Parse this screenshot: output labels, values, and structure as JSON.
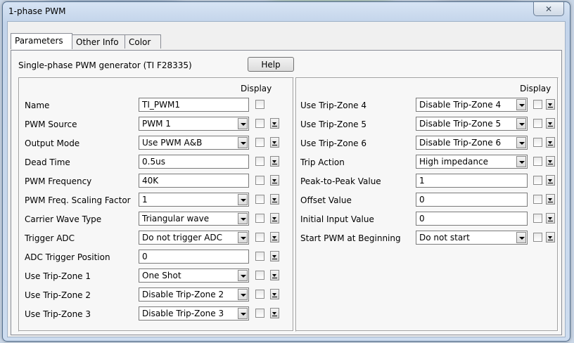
{
  "window": {
    "title": "1-phase PWM"
  },
  "tabs": [
    "Parameters",
    "Other Info",
    "Color"
  ],
  "header": {
    "subtitle": "Single-phase PWM generator (TI F28335)",
    "help_label": "Help"
  },
  "left": {
    "display_header": "Display",
    "rows": [
      {
        "label": "Name",
        "value": "TI_PWM1",
        "type": "text",
        "display_dropdown": false
      },
      {
        "label": "PWM Source",
        "value": "PWM 1",
        "type": "select",
        "display_dropdown": true
      },
      {
        "label": "Output Mode",
        "value": "Use PWM A&B",
        "type": "select",
        "display_dropdown": true
      },
      {
        "label": "Dead Time",
        "value": "0.5us",
        "type": "text",
        "display_dropdown": true
      },
      {
        "label": "PWM Frequency",
        "value": "40K",
        "type": "text",
        "display_dropdown": true
      },
      {
        "label": "PWM Freq. Scaling Factor",
        "value": "1",
        "type": "select",
        "display_dropdown": true
      },
      {
        "label": "Carrier Wave Type",
        "value": "Triangular wave",
        "type": "select",
        "display_dropdown": true
      },
      {
        "label": "Trigger ADC",
        "value": "Do not trigger ADC",
        "type": "select",
        "display_dropdown": true
      },
      {
        "label": "ADC Trigger Position",
        "value": "0",
        "type": "text",
        "display_dropdown": true
      },
      {
        "label": "Use Trip-Zone 1",
        "value": "One Shot",
        "type": "select",
        "display_dropdown": true
      },
      {
        "label": "Use Trip-Zone 2",
        "value": "Disable Trip-Zone 2",
        "type": "select",
        "display_dropdown": true
      },
      {
        "label": "Use Trip-Zone 3",
        "value": "Disable Trip-Zone 3",
        "type": "select",
        "display_dropdown": true
      }
    ]
  },
  "right": {
    "display_header": "Display",
    "rows": [
      {
        "label": "Use Trip-Zone 4",
        "value": "Disable Trip-Zone 4",
        "type": "select"
      },
      {
        "label": "Use Trip-Zone 5",
        "value": "Disable Trip-Zone 5",
        "type": "select"
      },
      {
        "label": "Use Trip-Zone 6",
        "value": "Disable Trip-Zone 6",
        "type": "select"
      },
      {
        "label": "Trip Action",
        "value": "High impedance",
        "type": "select"
      },
      {
        "label": "Peak-to-Peak Value",
        "value": "1",
        "type": "text"
      },
      {
        "label": "Offset Value",
        "value": "0",
        "type": "text"
      },
      {
        "label": "Initial Input Value",
        "value": "0",
        "type": "text"
      },
      {
        "label": "Start PWM at Beginning",
        "value": "Do not start",
        "type": "select"
      }
    ]
  },
  "icons": {
    "close": "close-icon",
    "dropdown": "chevron-down-icon"
  }
}
